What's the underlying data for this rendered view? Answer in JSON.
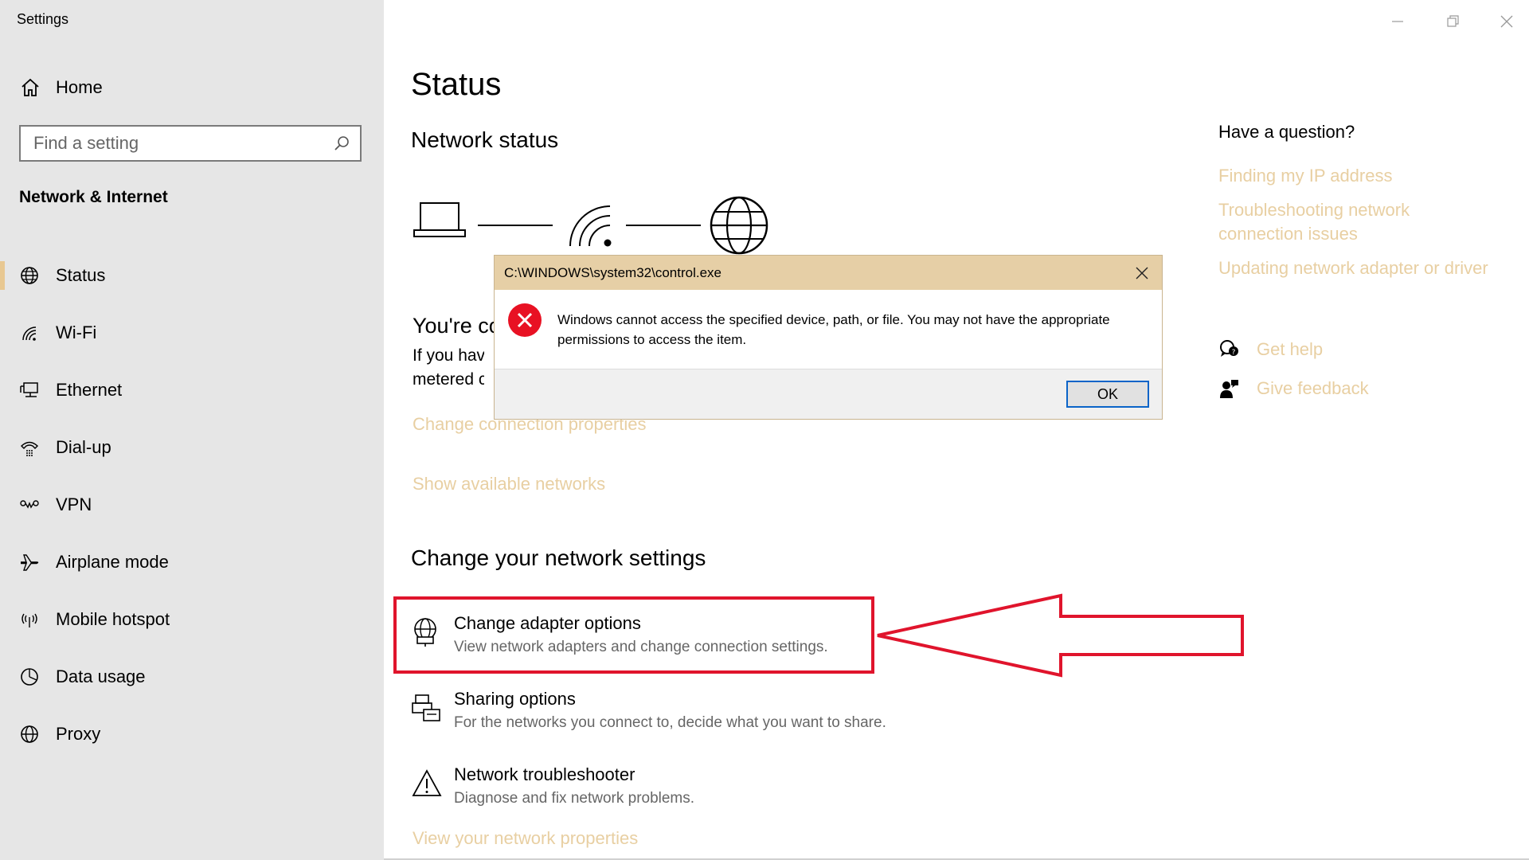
{
  "window": {
    "title": "Settings"
  },
  "sidebar": {
    "home_label": "Home",
    "search_placeholder": "Find a setting",
    "section_title": "Network & Internet",
    "items": [
      {
        "label": "Status",
        "icon": "globe-icon"
      },
      {
        "label": "Wi-Fi",
        "icon": "wifi-icon"
      },
      {
        "label": "Ethernet",
        "icon": "ethernet-icon"
      },
      {
        "label": "Dial-up",
        "icon": "dialup-icon"
      },
      {
        "label": "VPN",
        "icon": "vpn-icon"
      },
      {
        "label": "Airplane mode",
        "icon": "airplane-icon"
      },
      {
        "label": "Mobile hotspot",
        "icon": "hotspot-icon"
      },
      {
        "label": "Data usage",
        "icon": "data-usage-icon"
      },
      {
        "label": "Proxy",
        "icon": "globe-icon"
      }
    ],
    "active_index": 0
  },
  "main": {
    "title": "Status",
    "network_status_heading": "Network status",
    "connection_title_visible": "You're co",
    "connection_desc_line1": "If you have",
    "connection_desc_line2": "metered c",
    "links": {
      "change_connection": "Change connection properties",
      "show_networks": "Show available networks",
      "view_properties": "View your network properties"
    },
    "change_heading": "Change your network settings",
    "settings": [
      {
        "title": "Change adapter options",
        "desc": "View network adapters and change connection settings.",
        "icon": "adapter-icon"
      },
      {
        "title": "Sharing options",
        "desc": "For the networks you connect to, decide what you want to share.",
        "icon": "sharing-icon"
      },
      {
        "title": "Network troubleshooter",
        "desc": "Diagnose and fix network problems.",
        "icon": "warning-icon"
      }
    ]
  },
  "right": {
    "question": "Have a question?",
    "links": [
      "Finding my IP address",
      "Troubleshooting network connection issues",
      "Updating network adapter or driver"
    ],
    "get_help": "Get help",
    "give_feedback": "Give feedback"
  },
  "dialog": {
    "title": "C:\\WINDOWS\\system32\\control.exe",
    "message": "Windows cannot access the specified device, path, or file. You may not have the appropriate permissions to access the item.",
    "ok_label": "OK"
  },
  "colors": {
    "accent_link": "#e8cfa2",
    "sidebar_bg": "#e6e6e6",
    "annotation_red": "#e0142c",
    "dialog_title_bg": "#e6cfa6",
    "error_red": "#e81123"
  }
}
